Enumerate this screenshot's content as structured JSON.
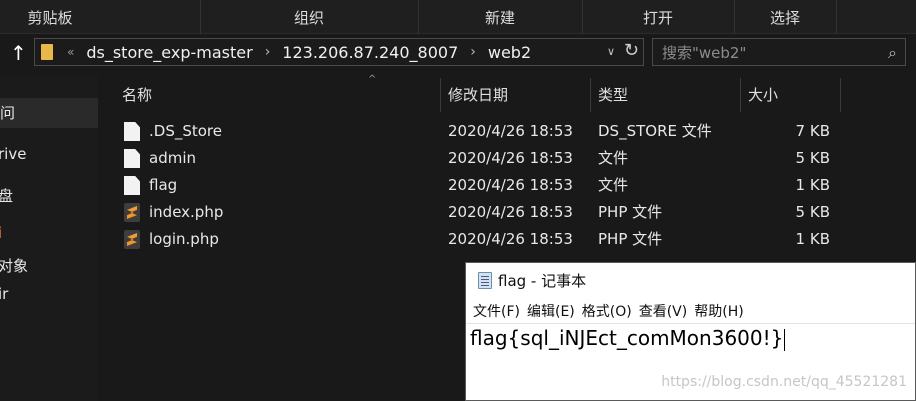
{
  "ribbon": {
    "groups": [
      "剪贴板",
      "组织",
      "新建",
      "打开",
      "选择"
    ]
  },
  "address": {
    "overflow": "«",
    "crumbs": [
      "ds_store_exp-master",
      "123.206.87.240_8007",
      "web2"
    ],
    "search_placeholder": "搜索\"web2\""
  },
  "nav": {
    "items": [
      "问",
      "rive",
      "盘",
      "i",
      "对象",
      "ir"
    ]
  },
  "list": {
    "columns": [
      "名称",
      "修改日期",
      "类型",
      "大小"
    ],
    "files": [
      {
        "name": ".DS_Store",
        "date": "2020/4/26 18:53",
        "type": "DS_STORE 文件",
        "size": "7 KB",
        "icon": "document-icon"
      },
      {
        "name": "admin",
        "date": "2020/4/26 18:53",
        "type": "文件",
        "size": "5 KB",
        "icon": "document-icon"
      },
      {
        "name": "flag",
        "date": "2020/4/26 18:53",
        "type": "文件",
        "size": "1 KB",
        "icon": "document-icon"
      },
      {
        "name": "index.php",
        "date": "2020/4/26 18:53",
        "type": "PHP 文件",
        "size": "5 KB",
        "icon": "sublime-php-icon"
      },
      {
        "name": "login.php",
        "date": "2020/4/26 18:53",
        "type": "PHP 文件",
        "size": "1 KB",
        "icon": "sublime-php-icon"
      }
    ]
  },
  "notepad": {
    "title": "flag - 记事本",
    "menu": [
      "文件(F)",
      "编辑(E)",
      "格式(O)",
      "查看(V)",
      "帮助(H)"
    ],
    "content": "flag{sql_iNJEct_comMon3600!}"
  },
  "watermark": "https://blog.csdn.net/qq_45521281",
  "colors": {
    "background": "#191919",
    "accent_orange": "#e0703c",
    "folder": "#e8b84a"
  }
}
